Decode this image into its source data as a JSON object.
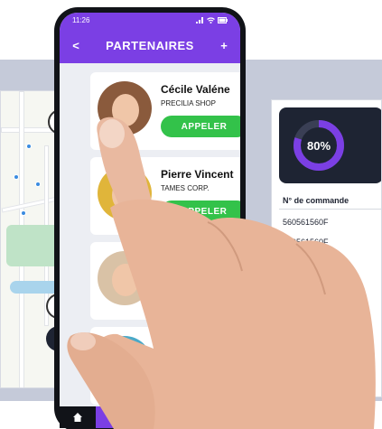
{
  "status_bar": {
    "time": "11:26"
  },
  "app_bar": {
    "title": "PARTENAIRES",
    "back_label": "<",
    "add_label": "+"
  },
  "partners": [
    {
      "name": "Cécile Valéne",
      "company": "PRECILIA SHOP",
      "action": "APPELER"
    },
    {
      "name": "Pierre Vincent",
      "company": "TAMES CORP.",
      "action": "APPELER"
    }
  ],
  "dashboard": {
    "kpi": {
      "value": "80%",
      "fraction": 0.8
    },
    "orders_header": "N° de commande",
    "orders": [
      "560561560F",
      "560561560F"
    ]
  },
  "colors": {
    "accent": "#7b3fe4",
    "call": "#33c24a",
    "kpi_card": "#1e2433"
  },
  "icons": [
    "signal-icon",
    "wifi-icon",
    "battery-icon",
    "search-icon",
    "compass-icon",
    "location-icon",
    "home-icon"
  ]
}
